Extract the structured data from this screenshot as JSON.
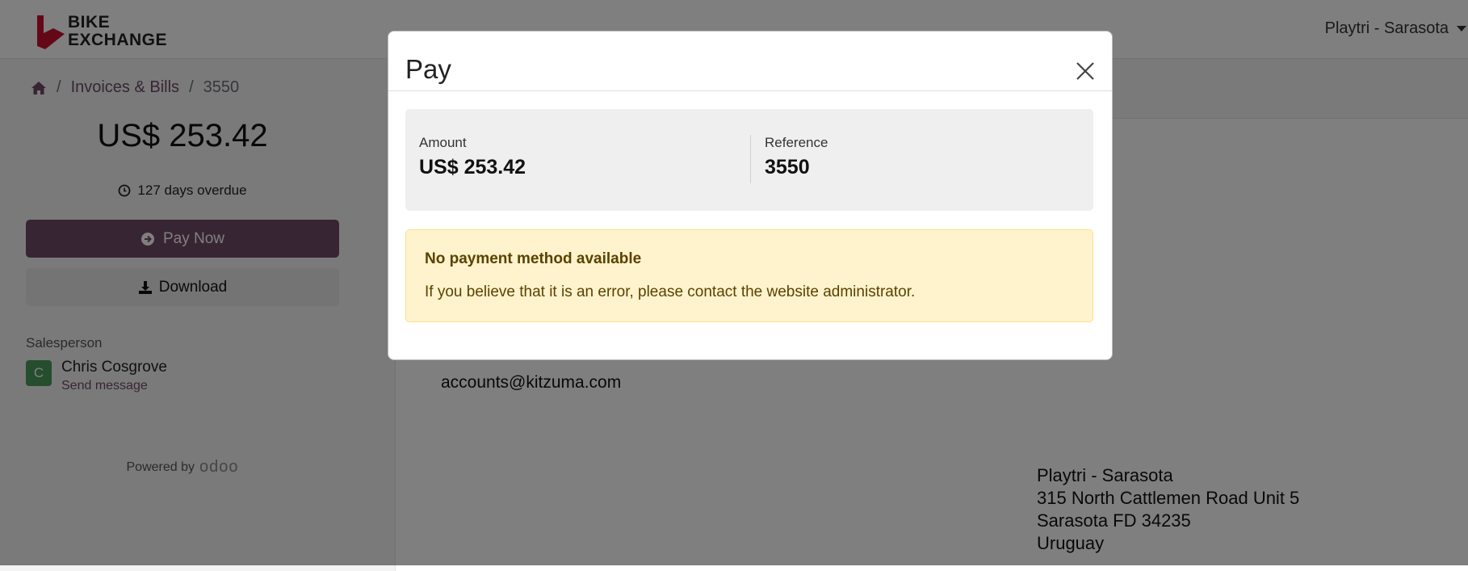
{
  "header": {
    "logo_line1": "BIKE",
    "logo_line2": "EXCHANGE",
    "user_menu": "Playtri - Sarasota"
  },
  "breadcrumb": {
    "items": [
      "Invoices & Bills",
      "3550"
    ]
  },
  "sidebar": {
    "amount": "US$ 253.42",
    "overdue": "127 days overdue",
    "pay_now": "Pay Now",
    "download": "Download",
    "salesperson_label": "Salesperson",
    "avatar_initial": "C",
    "salesperson_name": "Chris Cosgrove",
    "send_message": "Send message",
    "powered_by": "Powered by",
    "powered_brand": "odoo"
  },
  "document": {
    "email": "accounts@kitzuma.com",
    "address_lines": [
      "Playtri - Sarasota",
      "315 North Cattlemen Road Unit 5",
      "Sarasota FD 34235",
      "Uruguay"
    ]
  },
  "modal": {
    "title": "Pay",
    "amount_label": "Amount",
    "amount_value": "US$ 253.42",
    "reference_label": "Reference",
    "reference_value": "3550",
    "alert_title": "No payment method available",
    "alert_text": "If you believe that it is an error, please contact the website administrator."
  },
  "colors": {
    "primary": "#714b67",
    "warning_bg": "#fff3cd",
    "logo_red": "#c8102e"
  }
}
